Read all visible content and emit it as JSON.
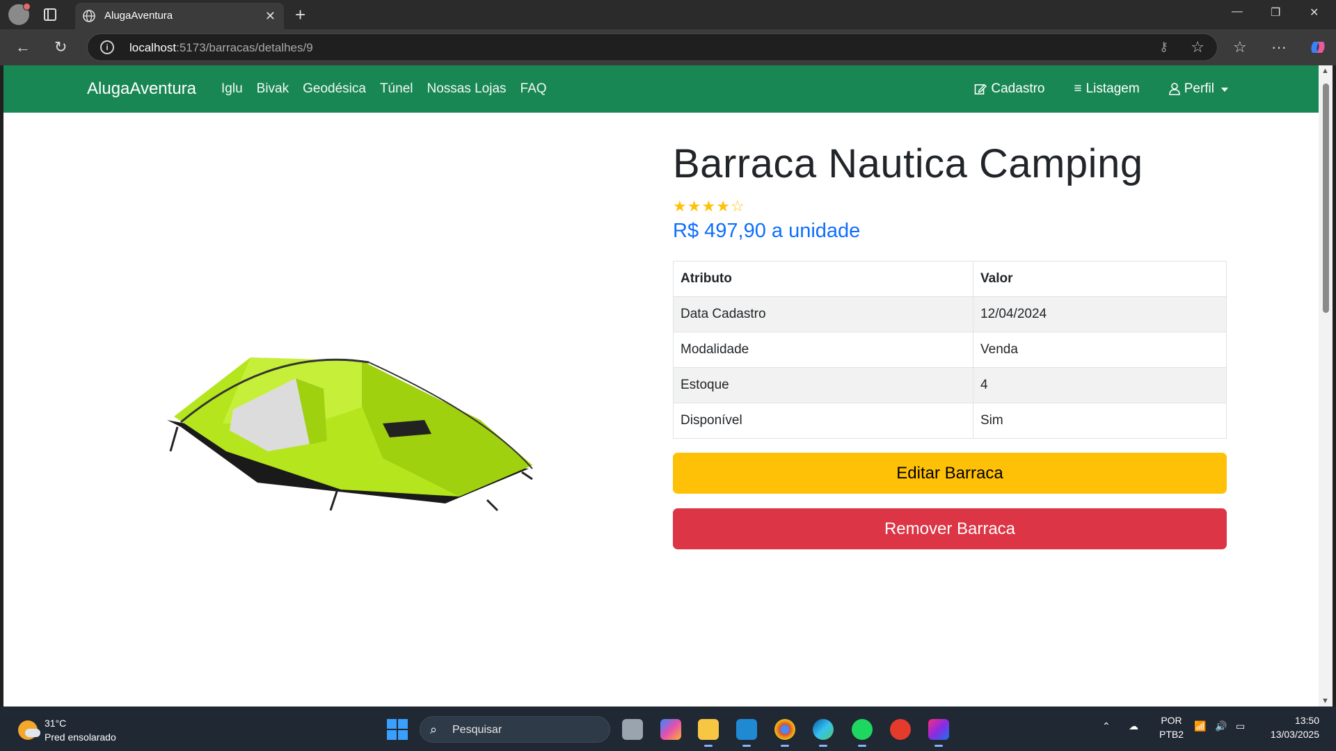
{
  "browser": {
    "tab_title": "AlugaAventura",
    "url_host": "localhost",
    "url_path": ":5173/barracas/detalhes/9"
  },
  "site": {
    "brand": "AlugaAventura",
    "menu": [
      "Iglu",
      "Bivak",
      "Geodésica",
      "Túnel",
      "Nossas Lojas",
      "FAQ"
    ],
    "right_menu": {
      "cadastro": "Cadastro",
      "listagem": "Listagem",
      "perfil": "Perfil"
    }
  },
  "product": {
    "title": "Barraca Nautica Camping",
    "rating": 4,
    "rating_max": 5,
    "price": "R$ 497,90 a unidade",
    "table_headers": [
      "Atributo",
      "Valor"
    ],
    "attributes": [
      {
        "name": "Data Cadastro",
        "value": "12/04/2024"
      },
      {
        "name": "Modalidade",
        "value": "Venda"
      },
      {
        "name": "Estoque",
        "value": "4"
      },
      {
        "name": "Disponível",
        "value": "Sim"
      }
    ],
    "edit_button": "Editar Barraca",
    "remove_button": "Remover Barraca"
  },
  "taskbar": {
    "temperature": "31°C",
    "weather": "Pred ensolarado",
    "search_placeholder": "Pesquisar",
    "lang_top": "POR",
    "lang_bottom": "PTB2",
    "time": "13:50",
    "date": "13/03/2025"
  },
  "colors": {
    "navbar": "#198754",
    "price": "#0d6efd",
    "edit": "#ffc107",
    "remove": "#dc3545",
    "tent": "#b5e61d"
  }
}
